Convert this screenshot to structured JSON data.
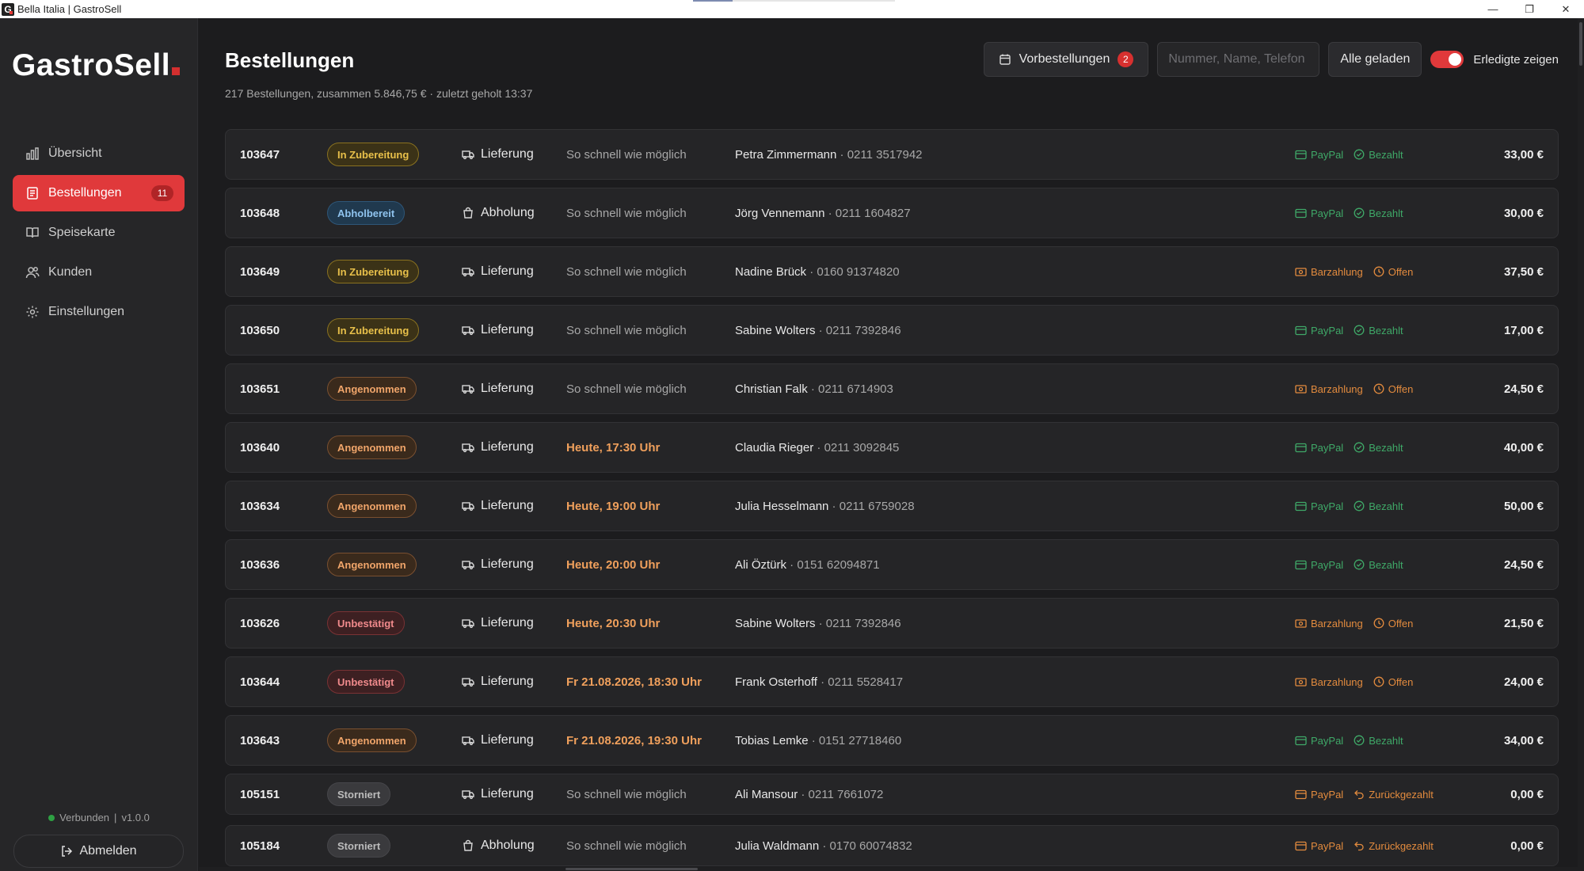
{
  "window": {
    "title": "Bella Italia | GastroSell",
    "app_icon_letter": "G",
    "minimize": "—",
    "maximize": "❐",
    "close": "✕"
  },
  "sidebar": {
    "logo": "GastroSell",
    "items": [
      {
        "label": "Übersicht",
        "icon": "chart-icon",
        "active": false
      },
      {
        "label": "Bestellungen",
        "icon": "receipt-icon",
        "active": true,
        "badge": "11"
      },
      {
        "label": "Speisekarte",
        "icon": "book-icon",
        "active": false
      },
      {
        "label": "Kunden",
        "icon": "users-icon",
        "active": false
      },
      {
        "label": "Einstellungen",
        "icon": "gear-icon",
        "active": false
      }
    ],
    "status": {
      "connected": "Verbunden",
      "separator": "|",
      "version": "v1.0.0"
    },
    "logout_label": "Abmelden"
  },
  "header": {
    "title": "Bestellungen",
    "subtitle": "217 Bestellungen, zusammen 5.846,75 € · zuletzt geholt 13:37",
    "preorders_label": "Vorbestellungen",
    "preorders_count": "2",
    "search_placeholder": "Nummer, Name, Telefon",
    "load_all_label": "Alle geladen",
    "show_done_label": "Erledigte zeigen",
    "show_done_on": true
  },
  "orders": [
    {
      "number": "103647",
      "status": "In Zubereitung",
      "status_kind": "prep",
      "type": "Lieferung",
      "time": "So schnell wie möglich",
      "scheduled": false,
      "name": "Petra Zimmermann",
      "phone": " · 0211 3517942",
      "payment": "PayPal",
      "pay_state": "Bezahlt",
      "pay_kind": "paid",
      "total": "33,00 €"
    },
    {
      "number": "103648",
      "status": "Abholbereit",
      "status_kind": "ready",
      "type": "Abholung",
      "time": "So schnell wie möglich",
      "scheduled": false,
      "name": "Jörg Vennemann",
      "phone": " · 0211 1604827",
      "payment": "PayPal",
      "pay_state": "Bezahlt",
      "pay_kind": "paid",
      "total": "30,00 €"
    },
    {
      "number": "103649",
      "status": "In Zubereitung",
      "status_kind": "prep",
      "type": "Lieferung",
      "time": "So schnell wie möglich",
      "scheduled": false,
      "name": "Nadine Brück",
      "phone": " · 0160 91374820",
      "payment": "Barzahlung",
      "pay_state": "Offen",
      "pay_kind": "open",
      "total": "37,50 €"
    },
    {
      "number": "103650",
      "status": "In Zubereitung",
      "status_kind": "prep",
      "type": "Lieferung",
      "time": "So schnell wie möglich",
      "scheduled": false,
      "name": "Sabine Wolters",
      "phone": " · 0211 7392846",
      "payment": "PayPal",
      "pay_state": "Bezahlt",
      "pay_kind": "paid",
      "total": "17,00 €"
    },
    {
      "number": "103651",
      "status": "Angenommen",
      "status_kind": "acc",
      "type": "Lieferung",
      "time": "So schnell wie möglich",
      "scheduled": false,
      "name": "Christian Falk",
      "phone": " · 0211 6714903",
      "payment": "Barzahlung",
      "pay_state": "Offen",
      "pay_kind": "open",
      "total": "24,50 €"
    },
    {
      "number": "103640",
      "status": "Angenommen",
      "status_kind": "acc",
      "type": "Lieferung",
      "time": "Heute, 17:30 Uhr",
      "scheduled": true,
      "name": "Claudia Rieger",
      "phone": " · 0211 3092845",
      "payment": "PayPal",
      "pay_state": "Bezahlt",
      "pay_kind": "paid",
      "total": "40,00 €"
    },
    {
      "number": "103634",
      "status": "Angenommen",
      "status_kind": "acc",
      "type": "Lieferung",
      "time": "Heute, 19:00 Uhr",
      "scheduled": true,
      "name": "Julia Hesselmann",
      "phone": " · 0211 6759028",
      "payment": "PayPal",
      "pay_state": "Bezahlt",
      "pay_kind": "paid",
      "total": "50,00 €"
    },
    {
      "number": "103636",
      "status": "Angenommen",
      "status_kind": "acc",
      "type": "Lieferung",
      "time": "Heute, 20:00 Uhr",
      "scheduled": true,
      "name": "Ali Öztürk",
      "phone": " · 0151 62094871",
      "payment": "PayPal",
      "pay_state": "Bezahlt",
      "pay_kind": "paid",
      "total": "24,50 €"
    },
    {
      "number": "103626",
      "status": "Unbestätigt",
      "status_kind": "unconf",
      "type": "Lieferung",
      "time": "Heute, 20:30 Uhr",
      "scheduled": true,
      "name": "Sabine Wolters",
      "phone": " · 0211 7392846",
      "payment": "Barzahlung",
      "pay_state": "Offen",
      "pay_kind": "open",
      "total": "21,50 €"
    },
    {
      "number": "103644",
      "status": "Unbestätigt",
      "status_kind": "unconf",
      "type": "Lieferung",
      "time": "Fr 21.08.2026, 18:30 Uhr",
      "scheduled": true,
      "name": "Frank Osterhoff",
      "phone": " · 0211 5528417",
      "payment": "Barzahlung",
      "pay_state": "Offen",
      "pay_kind": "open",
      "total": "24,00 €"
    },
    {
      "number": "103643",
      "status": "Angenommen",
      "status_kind": "acc",
      "type": "Lieferung",
      "time": "Fr 21.08.2026, 19:30 Uhr",
      "scheduled": true,
      "name": "Tobias Lemke",
      "phone": " · 0151 27718460",
      "payment": "PayPal",
      "pay_state": "Bezahlt",
      "pay_kind": "paid",
      "total": "34,00 €"
    },
    {
      "number": "105151",
      "status": "Storniert",
      "status_kind": "cancel",
      "type": "Lieferung",
      "time": "So schnell wie möglich",
      "scheduled": false,
      "name": "Ali Mansour",
      "phone": " · 0211 7661072",
      "payment": "PayPal",
      "pay_state": "Zurückgezahlt",
      "pay_kind": "refund",
      "total": "0,00 €"
    },
    {
      "number": "105184",
      "status": "Storniert",
      "status_kind": "cancel",
      "type": "Abholung",
      "time": "So schnell wie möglich",
      "scheduled": false,
      "name": "Julia Waldmann",
      "phone": " · 0170 60074832",
      "payment": "PayPal",
      "pay_state": "Zurückgezahlt",
      "pay_kind": "refund",
      "total": "0,00 €"
    }
  ]
}
